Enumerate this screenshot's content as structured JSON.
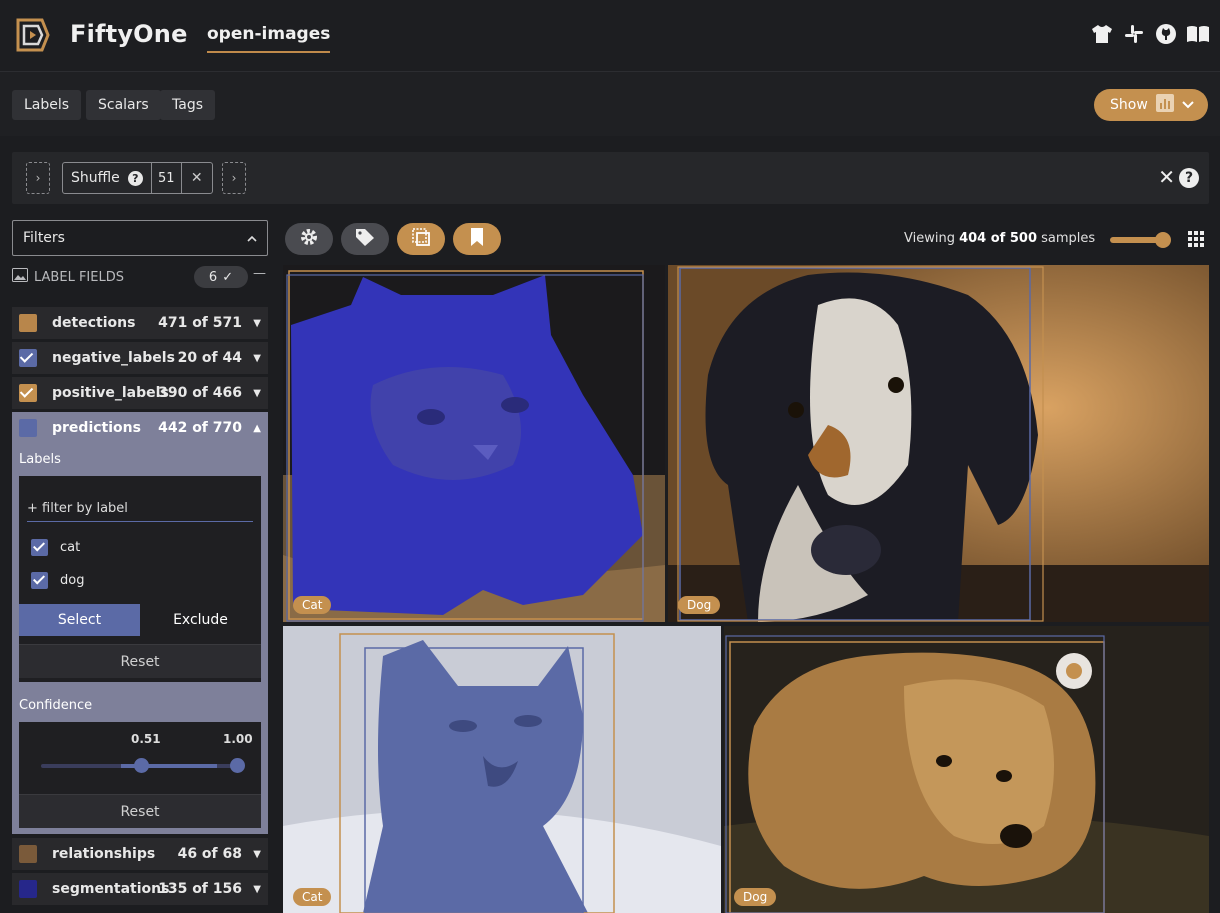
{
  "header": {
    "app_title": "FiftyOne",
    "dataset": "open-images",
    "icons": [
      "shirt-icon",
      "slack-icon",
      "github-icon",
      "book-icon"
    ]
  },
  "tabs": [
    {
      "label": "Labels"
    },
    {
      "label": "Scalars"
    },
    {
      "label": "Tags"
    }
  ],
  "show_button": {
    "label": "Show"
  },
  "view_bar": {
    "stage_name": "Shuffle",
    "stage_value": "51",
    "add_left": "›",
    "add_right": "›",
    "close": "✕",
    "help": "?"
  },
  "sidebar": {
    "filters_label": "Filters",
    "section_label": "LABEL FIELDS",
    "section_count": "6",
    "fields": [
      {
        "name": "detections",
        "count": "471 of 571",
        "color": "#b8864b",
        "checked": false
      },
      {
        "name": "negative_labels",
        "count": "20 of 44",
        "color": "#5b6aa6",
        "checked": true
      },
      {
        "name": "positive_labels",
        "count": "390 of 466",
        "color": "#c4904f",
        "checked": true
      },
      {
        "name": "relationships",
        "count": "46 of 68",
        "color": "#7a5a3a",
        "checked": false
      },
      {
        "name": "segmentations",
        "count": "135 of 156",
        "color": "#26278a",
        "checked": false
      }
    ],
    "expanded_field": {
      "name": "predictions",
      "count": "442 of 770",
      "color": "#5b6aa6",
      "labels_title": "Labels",
      "filter_placeholder": "+ filter by label",
      "label_values": [
        "cat",
        "dog"
      ],
      "select_label": "Select",
      "exclude_label": "Exclude",
      "reset_label": "Reset",
      "confidence_title": "Confidence",
      "confidence_min": "0.51",
      "confidence_max": "1.00",
      "confidence_reset_label": "Reset"
    }
  },
  "grid": {
    "viewing_prefix": "Viewing",
    "viewing_count": "404 of 500",
    "viewing_suffix": "samples",
    "samples": [
      {
        "tag": "Cat"
      },
      {
        "tag": "Dog"
      },
      {
        "tag": "Cat"
      },
      {
        "tag": "Dog"
      }
    ]
  },
  "colors": {
    "accent": "#c4904f",
    "primary": "#5b6aa6",
    "background": "#1c1d20"
  }
}
